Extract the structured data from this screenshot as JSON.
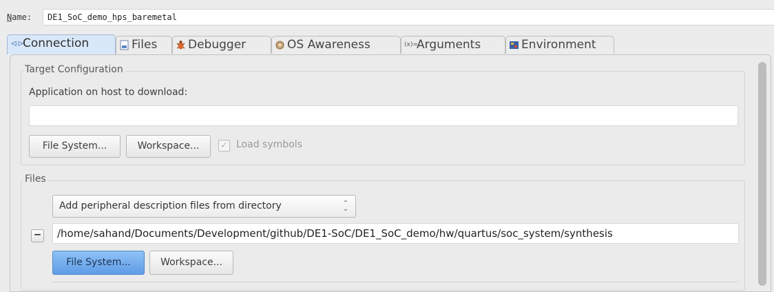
{
  "name_field": {
    "label": "Name:",
    "value": "DE1_SoC_demo_hps_baremetal"
  },
  "tabs": [
    {
      "label": "Connection",
      "icon": "connection-icon",
      "active": true
    },
    {
      "label": "Files",
      "icon": "files-icon",
      "active": false
    },
    {
      "label": "Debugger",
      "icon": "debugger-icon",
      "active": false
    },
    {
      "label": "OS Awareness",
      "icon": "os-awareness-icon",
      "active": false
    },
    {
      "label": "Arguments",
      "icon": "arguments-icon",
      "active": false
    },
    {
      "label": "Environment",
      "icon": "environment-icon",
      "active": false
    }
  ],
  "target_configuration": {
    "title": "Target Configuration",
    "app_label": "Application on host to download:",
    "app_value": "",
    "file_system_button": "File System...",
    "workspace_button": "Workspace...",
    "load_symbols": {
      "label": "Load symbols",
      "checked": true,
      "enabled": false
    }
  },
  "files": {
    "title": "Files",
    "combo_value": "Add peripheral description files from directory",
    "path_value": "/home/sahand/Documents/Development/github/DE1-SoC/DE1_SoC_demo/hw/quartus/soc_system/synthesis",
    "remove_button": "−",
    "file_system_button": "File System...",
    "workspace_button": "Workspace..."
  },
  "colors": {
    "active_tab_bg": "#d9e8f9",
    "primary_button": "#6aa6ec",
    "window_bg": "#ececec"
  }
}
